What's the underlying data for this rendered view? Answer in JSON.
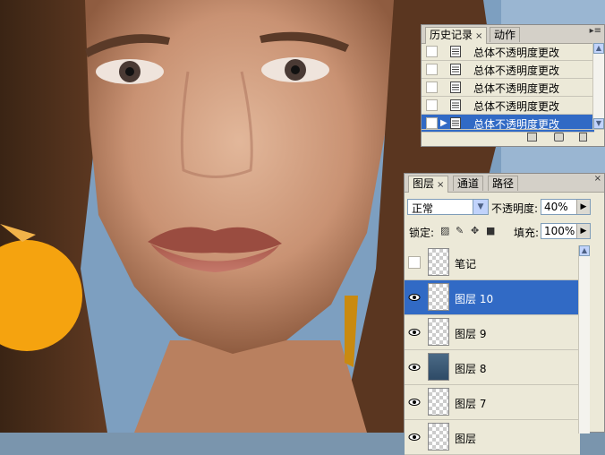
{
  "history_panel": {
    "tabs": [
      {
        "label": "历史记录",
        "close": "×"
      },
      {
        "label": "动作"
      }
    ],
    "rows": [
      {
        "label": "总体不透明度更改",
        "selected": false
      },
      {
        "label": "总体不透明度更改",
        "selected": false
      },
      {
        "label": "总体不透明度更改",
        "selected": false
      },
      {
        "label": "总体不透明度更改",
        "selected": false
      },
      {
        "label": "总体不透明度更改",
        "selected": true
      }
    ],
    "footer_icons": [
      "new-document-icon",
      "snapshot-camera-icon",
      "trash-icon"
    ]
  },
  "layers_panel": {
    "tabs": [
      {
        "label": "图层",
        "close": "×"
      },
      {
        "label": "通道"
      },
      {
        "label": "路径"
      }
    ],
    "blend_mode": "正常",
    "opacity_label": "不透明度:",
    "opacity_value": "40%",
    "lock_label": "锁定:",
    "fill_label": "填充:",
    "fill_value": "100%",
    "layers": [
      {
        "name": "笔记",
        "visible": false,
        "selected": false,
        "thumb": "transparent"
      },
      {
        "name": "图层 10",
        "visible": true,
        "selected": true,
        "thumb": "transparent"
      },
      {
        "name": "图层 9",
        "visible": true,
        "selected": false,
        "thumb": "transparent"
      },
      {
        "name": "图层 8",
        "visible": true,
        "selected": false,
        "thumb": "photo"
      },
      {
        "name": "图层 7",
        "visible": true,
        "selected": false,
        "thumb": "transparent"
      },
      {
        "name": "图层",
        "visible": true,
        "selected": false,
        "thumb": "transparent"
      }
    ]
  },
  "colors": {
    "selection": "#316ac5",
    "panel_bg": "#ece9d8",
    "earring": "#f5a30f"
  }
}
